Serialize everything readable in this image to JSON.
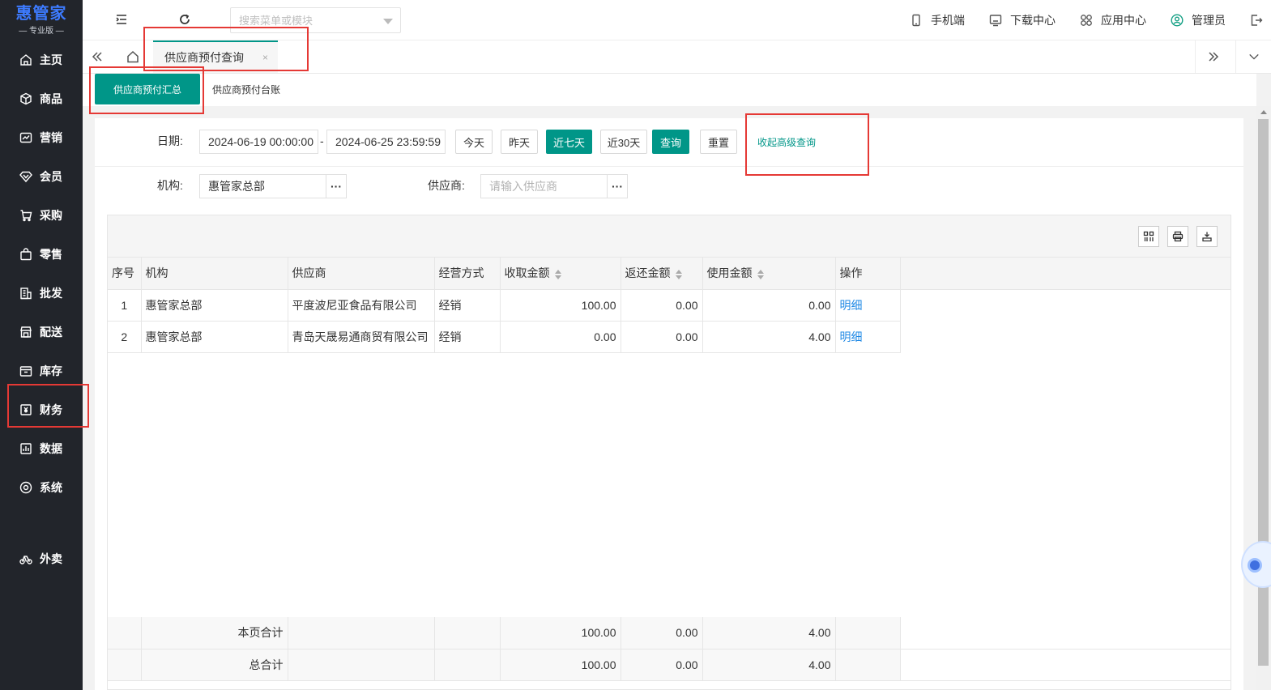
{
  "brand": {
    "name": "惠管家",
    "edition": "— 专业版 —"
  },
  "sidebar": {
    "items": [
      {
        "label": "主页",
        "icon": "home-icon"
      },
      {
        "label": "商品",
        "icon": "box-icon"
      },
      {
        "label": "营销",
        "icon": "chart-card-icon"
      },
      {
        "label": "会员",
        "icon": "diamond-icon"
      },
      {
        "label": "采购",
        "icon": "cart-icon"
      },
      {
        "label": "零售",
        "icon": "bag-icon"
      },
      {
        "label": "批发",
        "icon": "building-icon"
      },
      {
        "label": "配送",
        "icon": "store-icon"
      },
      {
        "label": "库存",
        "icon": "inventory-icon"
      },
      {
        "label": "财务",
        "icon": "finance-icon"
      },
      {
        "label": "数据",
        "icon": "data-icon"
      },
      {
        "label": "系统",
        "icon": "settings-icon"
      },
      {
        "label": "外卖",
        "icon": "bike-icon"
      }
    ]
  },
  "header": {
    "search_placeholder": "搜索菜单或模块",
    "links": {
      "mobile": "手机端",
      "download": "下载中心",
      "apps": "应用中心",
      "admin": "管理员"
    }
  },
  "tabs": {
    "active": "供应商预付查询",
    "close": "×"
  },
  "subtabs": {
    "summary": "供应商预付汇总",
    "ledger": "供应商预付台账"
  },
  "filters": {
    "date_label": "日期:",
    "date_from": "2024-06-19 00:00:00",
    "date_sep": "-",
    "date_to": "2024-06-25 23:59:59",
    "btn_today": "今天",
    "btn_yesterday": "昨天",
    "btn_7days": "近七天",
    "btn_30days": "近30天",
    "btn_query": "查询",
    "btn_reset": "重置",
    "collapse_link": "收起高级查询",
    "org_label": "机构:",
    "org_value": "惠管家总部",
    "supplier_label": "供应商:",
    "supplier_placeholder": "请输入供应商",
    "dots": "···"
  },
  "table": {
    "headers": [
      "序号",
      "机构",
      "供应商",
      "经营方式",
      "收取金额",
      "返还金额",
      "使用金额",
      "操作"
    ],
    "rows": [
      {
        "idx": "1",
        "org": "惠管家总部",
        "supplier": "平度波尼亚食品有限公司",
        "mode": "经销",
        "received": "100.00",
        "returned": "0.00",
        "used": "0.00",
        "action": "明细"
      },
      {
        "idx": "2",
        "org": "惠管家总部",
        "supplier": "青岛天晟易通商贸有限公司",
        "mode": "经销",
        "received": "0.00",
        "returned": "0.00",
        "used": "4.00",
        "action": "明细"
      }
    ],
    "totals": [
      {
        "label": "本页合计",
        "received": "100.00",
        "returned": "0.00",
        "used": "4.00"
      },
      {
        "label": "总合计",
        "received": "100.00",
        "returned": "0.00",
        "used": "4.00"
      }
    ]
  },
  "colors": {
    "accent": "#009688",
    "sidebar_bg": "#22252b",
    "link": "#1e88e5",
    "annotation": "#e53935"
  }
}
